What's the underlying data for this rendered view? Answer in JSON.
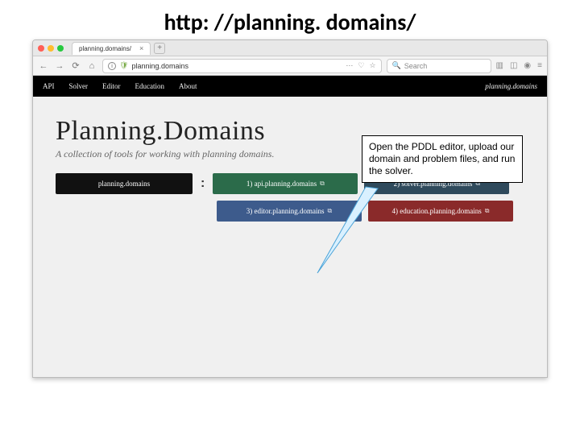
{
  "slide_title": "http: //planning. domains/",
  "browser": {
    "tab_label": "planning.domains/",
    "url_display": "planning.domains",
    "search_placeholder": "Search"
  },
  "navbar": {
    "items": [
      "API",
      "Solver",
      "Editor",
      "Education",
      "About"
    ],
    "brand": "planning.domains"
  },
  "page": {
    "heading": "Planning.Domains",
    "subtitle": "A collection of tools for working with planning domains."
  },
  "blocks": {
    "label": "planning.domains",
    "api": "1) api.planning.domains",
    "solver": "2) solver.planning.domains",
    "editor": "3) editor.planning.domains",
    "education": "4) education.planning.domains"
  },
  "callout": "Open the PDDL editor, upload our domain and problem files, and run the solver."
}
